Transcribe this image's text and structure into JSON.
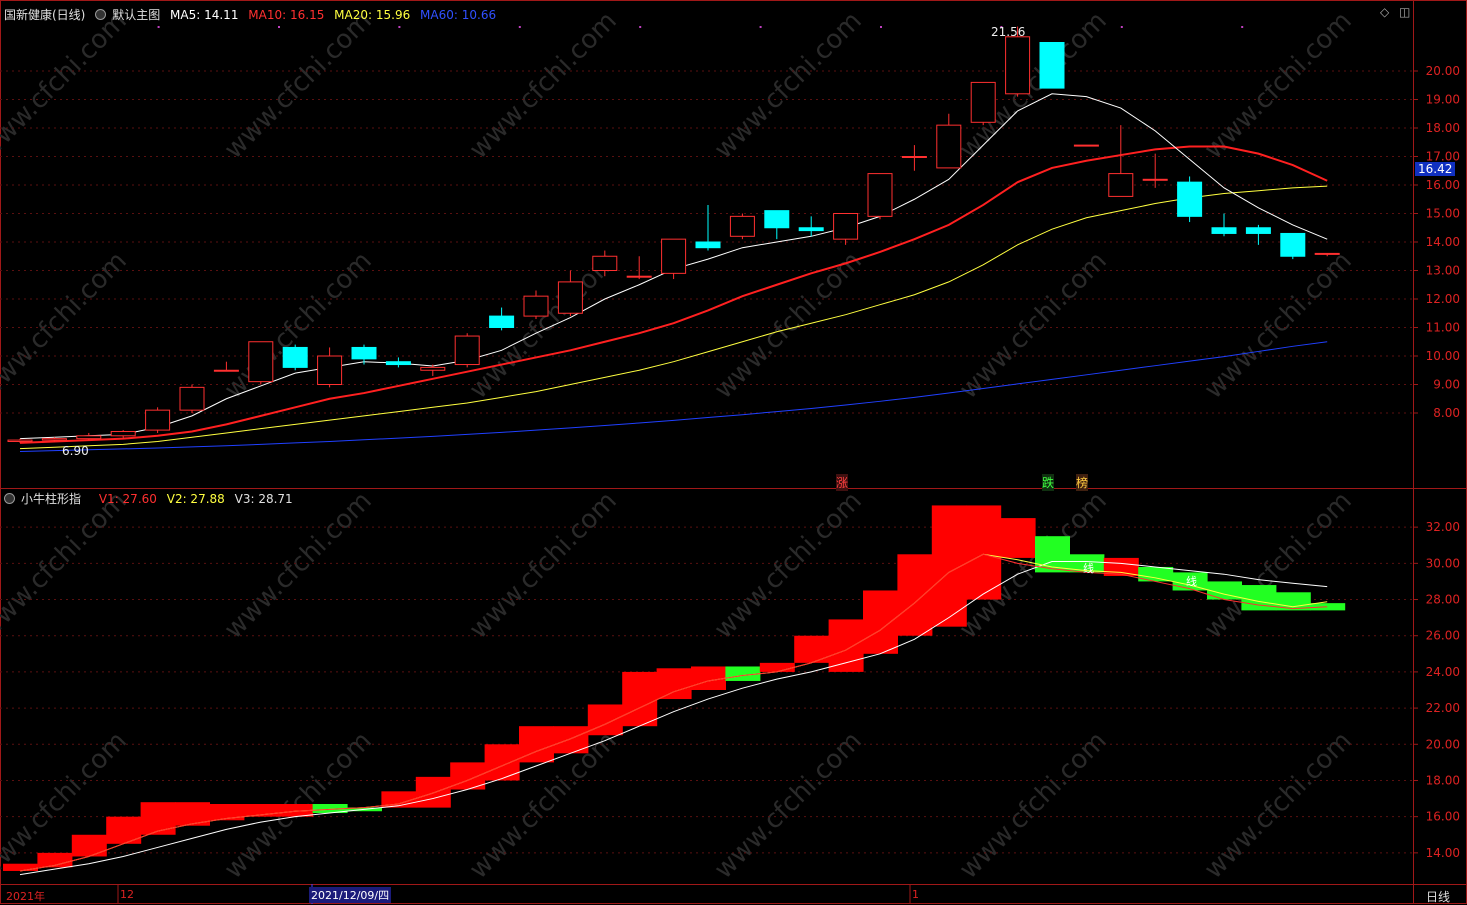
{
  "header": {
    "title": "国新健康(日线)",
    "main_name": "默认主图",
    "ma5": "MA5: 14.11",
    "ma10": "MA10: 16.15",
    "ma20": "MA20: 15.96",
    "ma60": "MA60: 10.66"
  },
  "sub_header": {
    "name": "小牛柱形指",
    "v1": "V1: 27.60",
    "v2": "V2: 27.88",
    "v3": "V3: 28.71"
  },
  "annotations": {
    "high": "21.56",
    "low": "6.90",
    "last_price": "16.42",
    "zhang": "涨",
    "die": "跌",
    "bang": "榜",
    "xian1": "线",
    "xian2": "线"
  },
  "xaxis": {
    "year": "2021年",
    "m12": "12",
    "crosshair_date": "2021/12/09/四",
    "m1": "1",
    "period": "日线"
  },
  "colors": {
    "up": "#ff3030",
    "down": "#00ffff",
    "ma5": "#ffffff",
    "ma10": "#ff2020",
    "ma20": "#ffff40",
    "ma60": "#2040ff",
    "bar_up": "#ff0000",
    "bar_down": "#22ff22"
  },
  "watermark": "www.cfchi.com",
  "chart_data": [
    {
      "type": "candlestick",
      "yticks": [
        8,
        9,
        10,
        11,
        12,
        13,
        14,
        15,
        16,
        17,
        18,
        19,
        20
      ],
      "ylim": [
        6.0,
        22.0
      ],
      "candles": [
        [
          7.0,
          7.05,
          6.95,
          7.1
        ],
        [
          7.05,
          7.1,
          7.0,
          7.15
        ],
        [
          7.1,
          7.2,
          7.05,
          7.3
        ],
        [
          7.2,
          7.35,
          7.1,
          7.4
        ],
        [
          7.4,
          8.1,
          7.3,
          8.2
        ],
        [
          8.1,
          8.9,
          8.0,
          9.0
        ],
        [
          9.5,
          9.5,
          9.5,
          9.8
        ],
        [
          9.1,
          10.5,
          9.0,
          10.5
        ],
        [
          10.3,
          9.6,
          9.5,
          10.4
        ],
        [
          9.0,
          10.0,
          8.9,
          10.3
        ],
        [
          10.3,
          9.9,
          9.7,
          10.4
        ],
        [
          9.8,
          9.7,
          9.6,
          9.95
        ],
        [
          9.5,
          9.6,
          9.3,
          9.7
        ],
        [
          9.7,
          10.7,
          9.6,
          10.8
        ],
        [
          11.4,
          11.0,
          10.9,
          11.7
        ],
        [
          11.4,
          12.1,
          11.3,
          12.3
        ],
        [
          11.5,
          12.6,
          11.4,
          13.0
        ],
        [
          13.0,
          13.5,
          12.8,
          13.7
        ],
        [
          12.8,
          12.8,
          12.7,
          13.5
        ],
        [
          12.9,
          14.1,
          12.7,
          14.1
        ],
        [
          14.0,
          13.8,
          13.7,
          15.3
        ],
        [
          14.2,
          14.9,
          14.1,
          15.0
        ],
        [
          15.1,
          14.5,
          14.1,
          15.1
        ],
        [
          14.5,
          14.4,
          14.2,
          14.9
        ],
        [
          14.1,
          15.0,
          13.9,
          15.0
        ],
        [
          14.9,
          16.4,
          14.8,
          16.4
        ],
        [
          17.0,
          17.0,
          16.5,
          17.4
        ],
        [
          16.6,
          18.1,
          16.6,
          18.5
        ],
        [
          18.2,
          19.6,
          18.1,
          19.6
        ],
        [
          19.2,
          21.2,
          19.1,
          21.56
        ],
        [
          21.0,
          19.4,
          19.4,
          21.0
        ],
        [
          17.4,
          17.4,
          17.4,
          17.4
        ],
        [
          15.6,
          16.4,
          15.6,
          18.1
        ],
        [
          16.2,
          16.2,
          15.9,
          17.1
        ],
        [
          16.1,
          14.9,
          14.7,
          16.3
        ],
        [
          14.5,
          14.3,
          14.2,
          15.0
        ],
        [
          14.5,
          14.3,
          13.9,
          14.6
        ],
        [
          14.3,
          13.5,
          13.4,
          14.3
        ],
        [
          13.6,
          13.6,
          13.5,
          13.6
        ]
      ],
      "ma5": [
        7.1,
        7.15,
        7.2,
        7.25,
        7.5,
        7.9,
        8.5,
        8.95,
        9.4,
        9.6,
        9.8,
        9.75,
        9.65,
        9.85,
        10.2,
        10.8,
        11.35,
        12.0,
        12.5,
        13.05,
        13.4,
        13.8,
        14.0,
        14.2,
        14.5,
        14.9,
        15.5,
        16.2,
        17.4,
        18.6,
        19.2,
        19.1,
        18.7,
        17.9,
        16.9,
        15.9,
        15.2,
        14.6,
        14.1
      ],
      "ma10": [
        6.95,
        7.0,
        7.05,
        7.1,
        7.2,
        7.35,
        7.6,
        7.9,
        8.2,
        8.5,
        8.7,
        8.95,
        9.2,
        9.45,
        9.7,
        9.95,
        10.2,
        10.5,
        10.8,
        11.15,
        11.6,
        12.1,
        12.5,
        12.9,
        13.25,
        13.65,
        14.1,
        14.6,
        15.3,
        16.1,
        16.6,
        16.85,
        17.05,
        17.25,
        17.35,
        17.35,
        17.1,
        16.7,
        16.15
      ],
      "ma20": [
        6.75,
        6.8,
        6.85,
        6.9,
        7.0,
        7.15,
        7.3,
        7.45,
        7.6,
        7.75,
        7.9,
        8.05,
        8.2,
        8.35,
        8.55,
        8.75,
        9.0,
        9.25,
        9.5,
        9.8,
        10.15,
        10.5,
        10.85,
        11.15,
        11.45,
        11.8,
        12.15,
        12.6,
        13.2,
        13.9,
        14.45,
        14.85,
        15.1,
        15.35,
        15.55,
        15.7,
        15.8,
        15.9,
        15.96
      ],
      "ma60": [
        6.65,
        6.68,
        6.71,
        6.74,
        6.77,
        6.81,
        6.85,
        6.9,
        6.95,
        7.0,
        7.06,
        7.12,
        7.18,
        7.25,
        7.32,
        7.4,
        7.48,
        7.56,
        7.65,
        7.74,
        7.84,
        7.94,
        8.05,
        8.16,
        8.28,
        8.41,
        8.55,
        8.7,
        8.86,
        9.02,
        9.18,
        9.34,
        9.5,
        9.66,
        9.82,
        9.98,
        10.16,
        10.34,
        10.5
      ]
    },
    {
      "type": "bar",
      "yticks": [
        14,
        16,
        18,
        20,
        22,
        24,
        26,
        28,
        30,
        32
      ],
      "ylim": [
        12.5,
        33.5
      ],
      "bars": [
        [
          13.0,
          13.4,
          "up"
        ],
        [
          13.2,
          14.0,
          "up"
        ],
        [
          13.8,
          15.0,
          "up"
        ],
        [
          14.5,
          16.0,
          "up"
        ],
        [
          15.0,
          16.8,
          "up"
        ],
        [
          15.5,
          16.8,
          "up"
        ],
        [
          15.8,
          16.7,
          "up"
        ],
        [
          16.0,
          16.7,
          "up"
        ],
        [
          16.0,
          16.7,
          "up"
        ],
        [
          16.2,
          16.7,
          "down"
        ],
        [
          16.3,
          16.5,
          "down"
        ],
        [
          16.5,
          17.4,
          "up"
        ],
        [
          16.5,
          18.2,
          "up"
        ],
        [
          17.5,
          19.0,
          "up"
        ],
        [
          18.0,
          20.0,
          "up"
        ],
        [
          19.0,
          21.0,
          "up"
        ],
        [
          19.5,
          21.0,
          "up"
        ],
        [
          20.5,
          22.2,
          "up"
        ],
        [
          21.0,
          24.0,
          "up"
        ],
        [
          22.5,
          24.2,
          "up"
        ],
        [
          23.0,
          24.3,
          "up"
        ],
        [
          23.5,
          24.3,
          "down"
        ],
        [
          24.0,
          24.5,
          "up"
        ],
        [
          24.5,
          26.0,
          "up"
        ],
        [
          24.0,
          26.9,
          "up"
        ],
        [
          25.0,
          28.5,
          "up"
        ],
        [
          26.0,
          30.5,
          "up"
        ],
        [
          26.5,
          33.2,
          "up"
        ],
        [
          28.0,
          33.2,
          "up"
        ],
        [
          30.3,
          32.5,
          "up"
        ],
        [
          29.5,
          31.5,
          "down"
        ],
        [
          29.5,
          30.5,
          "down"
        ],
        [
          29.3,
          30.3,
          "up"
        ],
        [
          29.0,
          29.8,
          "down"
        ],
        [
          28.5,
          29.5,
          "down"
        ],
        [
          28.0,
          29.0,
          "down"
        ],
        [
          27.4,
          28.8,
          "down"
        ],
        [
          27.4,
          28.4,
          "down"
        ],
        [
          27.4,
          27.8,
          "down"
        ]
      ],
      "v3": [
        12.8,
        13.1,
        13.4,
        13.8,
        14.3,
        14.8,
        15.3,
        15.7,
        16.0,
        16.2,
        16.4,
        16.6,
        17.0,
        17.5,
        18.1,
        18.8,
        19.5,
        20.2,
        21.0,
        21.8,
        22.5,
        23.1,
        23.6,
        24.0,
        24.5,
        25.0,
        25.8,
        27.0,
        28.3,
        29.4,
        30.1,
        30.1,
        30.0,
        29.8,
        29.6,
        29.4,
        29.1,
        28.9,
        28.71
      ],
      "v2": [
        13.0,
        13.3,
        13.8,
        14.5,
        15.2,
        15.6,
        15.9,
        16.1,
        16.3,
        16.4,
        16.5,
        16.7,
        17.3,
        18.0,
        18.8,
        19.6,
        20.3,
        21.1,
        22.0,
        22.9,
        23.5,
        23.8,
        24.0,
        24.5,
        25.2,
        26.3,
        27.8,
        29.5,
        30.5,
        30.2,
        29.8,
        29.6,
        29.5,
        29.2,
        28.8,
        28.3,
        27.9,
        27.6,
        27.88
      ],
      "v1": [
        13.0,
        13.3,
        13.8,
        14.5,
        15.2,
        15.6,
        15.9,
        16.1,
        16.3,
        16.4,
        16.5,
        16.7,
        17.3,
        18.0,
        18.8,
        19.6,
        20.3,
        21.1,
        22.0,
        22.9,
        23.5,
        23.8,
        24.0,
        24.5,
        25.2,
        26.3,
        27.8,
        29.5,
        30.5,
        30.0,
        29.7,
        29.5,
        29.4,
        29.0,
        28.6,
        28.0,
        27.7,
        27.5,
        27.6
      ]
    }
  ]
}
